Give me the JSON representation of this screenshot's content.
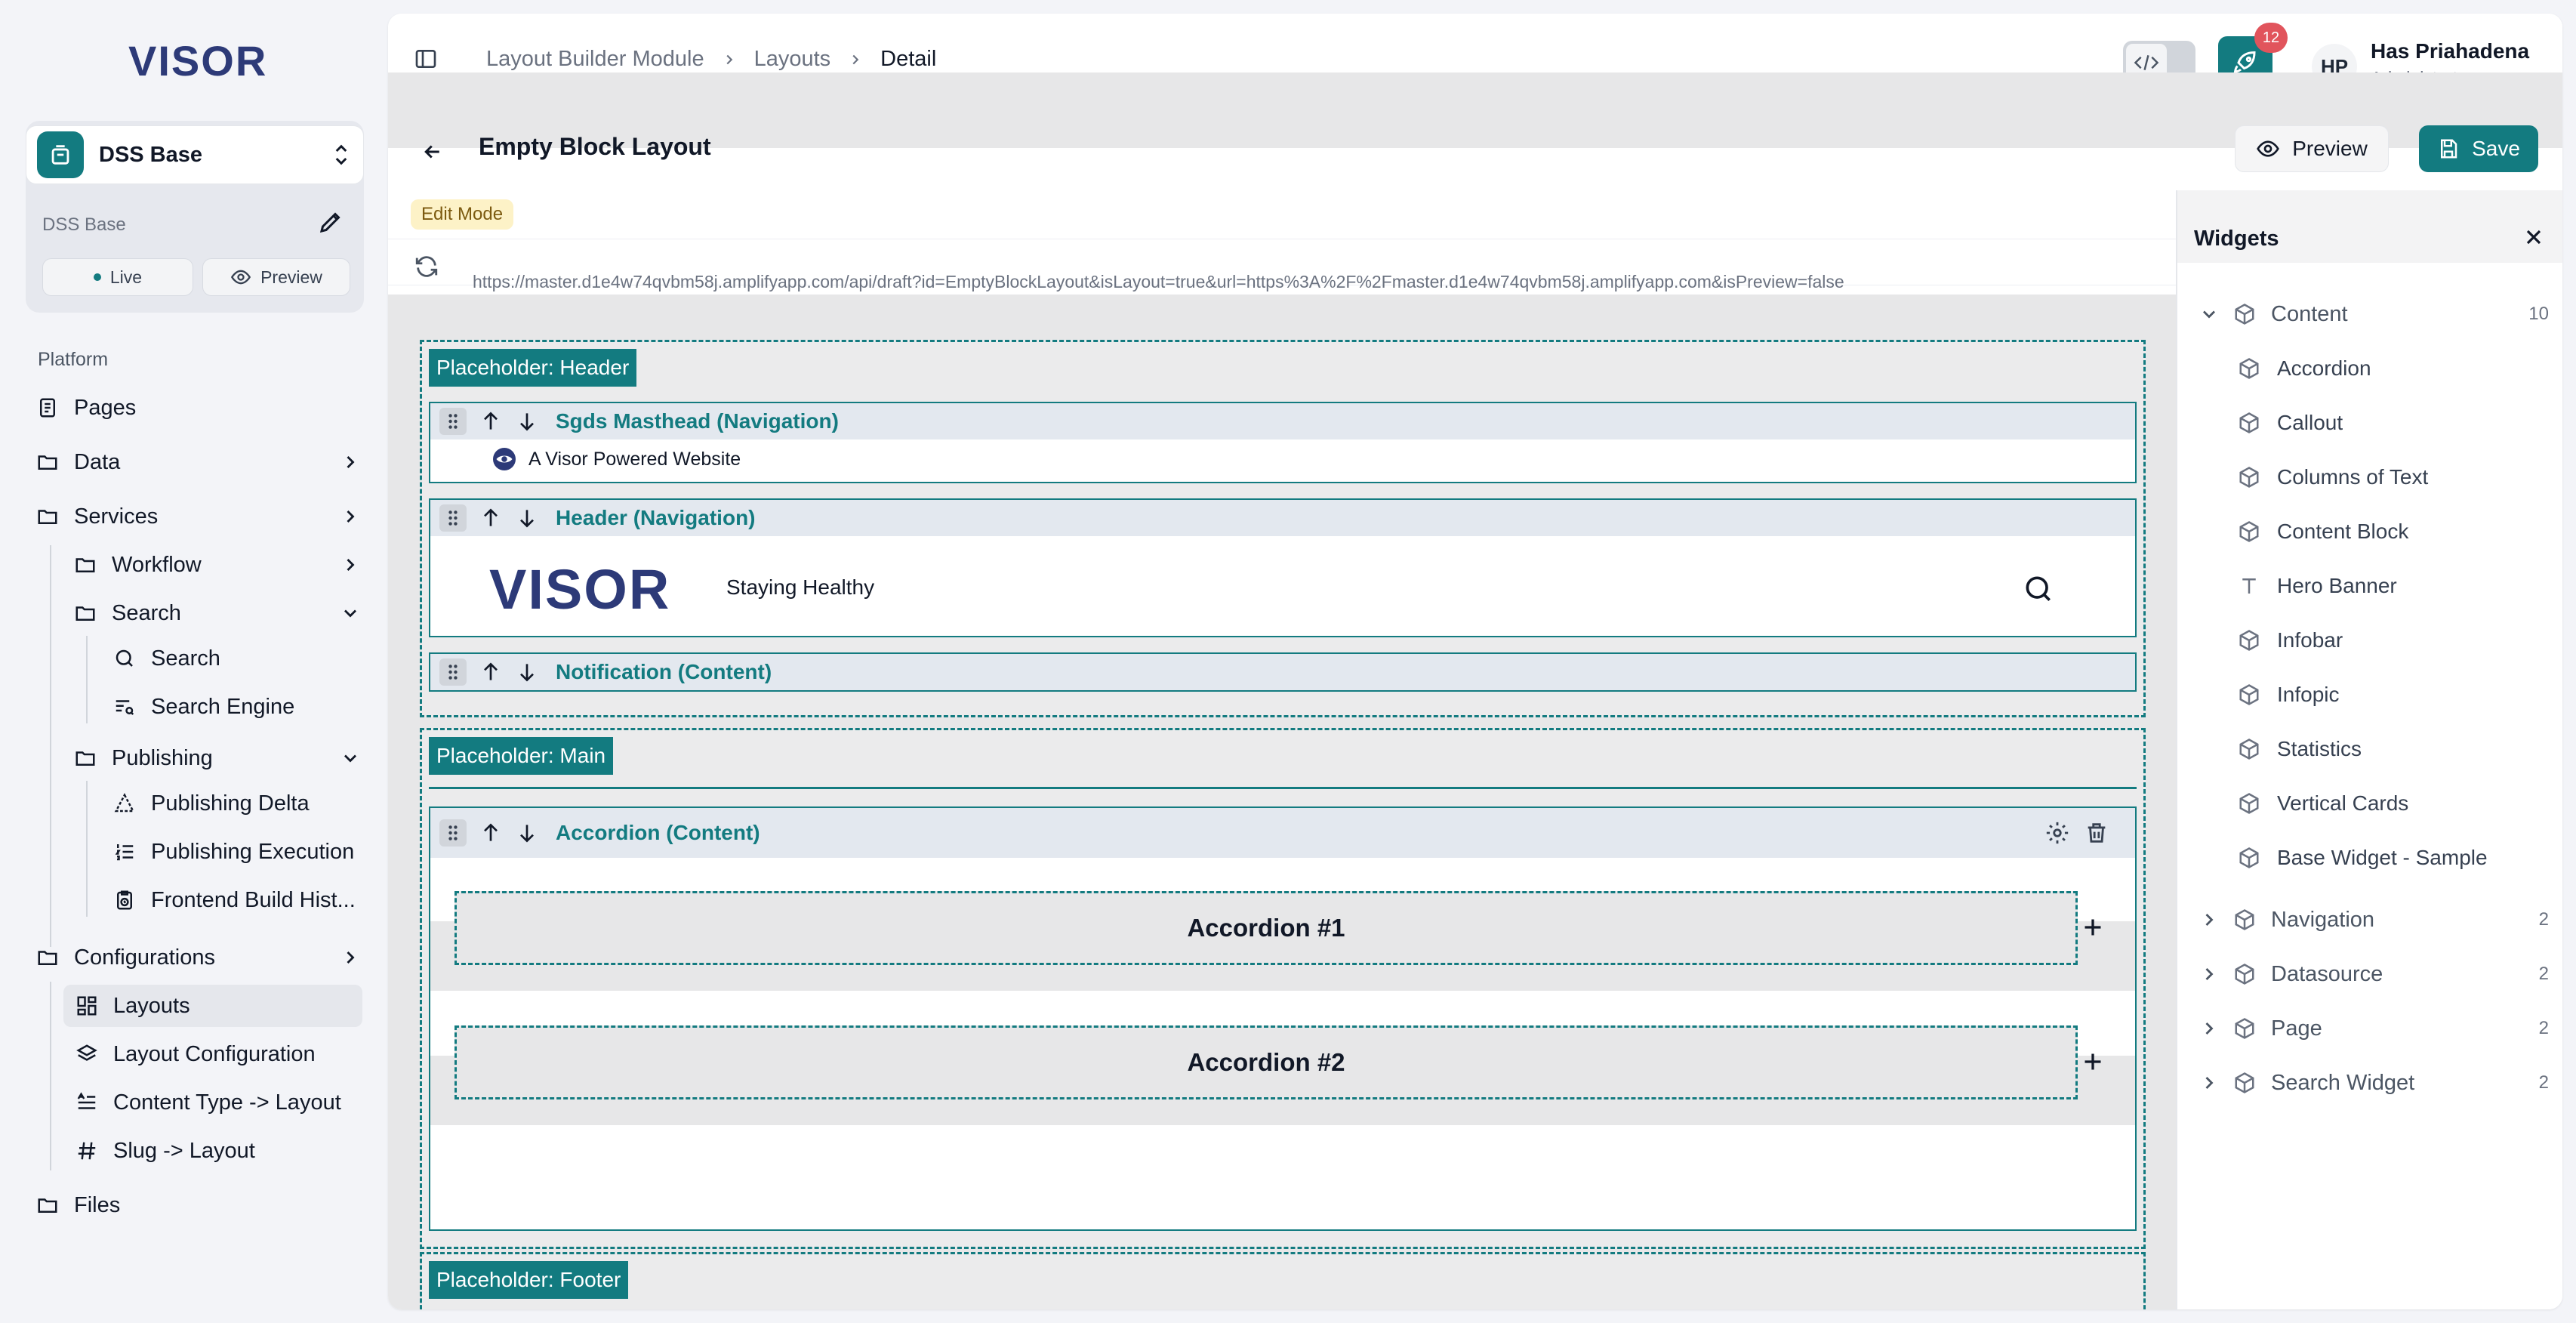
{
  "sidebar": {
    "logo": "VISOR",
    "workspace": {
      "name": "DSS Base",
      "sub": "DSS Base",
      "live": "Live",
      "preview": "Preview"
    },
    "section": "Platform",
    "items": [
      {
        "label": "Pages"
      },
      {
        "label": "Data"
      },
      {
        "label": "Services"
      },
      {
        "label": "Workflow"
      },
      {
        "label": "Search"
      },
      {
        "label": "Search"
      },
      {
        "label": "Search Engine"
      },
      {
        "label": "Publishing"
      },
      {
        "label": "Publishing Delta"
      },
      {
        "label": "Publishing Execution"
      },
      {
        "label": "Frontend Build Hist..."
      },
      {
        "label": "Configurations"
      },
      {
        "label": "Layouts"
      },
      {
        "label": "Layout Configuration"
      },
      {
        "label": "Content Type -> Layout"
      },
      {
        "label": "Slug -> Layout"
      },
      {
        "label": "Files"
      }
    ]
  },
  "topbar": {
    "breadcrumbs": [
      "Layout Builder Module",
      "Layouts",
      "Detail"
    ],
    "badge": "12",
    "user": {
      "initials": "HP",
      "name": "Has Priahadena",
      "role": "Administrator"
    }
  },
  "page": {
    "title": "Empty Block Layout",
    "preview_label": "Preview",
    "save_label": "Save",
    "mode": "Edit Mode",
    "url": "https://master.d1e4w74qvbm58j.amplifyapp.com/api/draft?id=EmptyBlockLayout&isLayout=true&url=https%3A%2F%2Fmaster.d1e4w74qvbm58j.amplifyapp.com&isPreview=false"
  },
  "canvas": {
    "header_tag": "Placeholder: Header",
    "masthead_title": "Sgds Masthead (Navigation)",
    "masthead_text": "A Visor Powered Website",
    "header_title": "Header (Navigation)",
    "header_logo": "VISOR",
    "header_tagline": "Staying Healthy",
    "notification_title": "Notification (Content)",
    "main_tag": "Placeholder: Main",
    "accordion_title": "Accordion (Content)",
    "accordion_1": "Accordion #1",
    "accordion_2": "Accordion #2",
    "footer_tag": "Placeholder: Footer"
  },
  "widgets": {
    "title": "Widgets",
    "content_group": {
      "label": "Content",
      "count": "10"
    },
    "content_items": [
      "Accordion",
      "Callout",
      "Columns of Text",
      "Content Block",
      "Hero Banner",
      "Infobar",
      "Infopic",
      "Statistics",
      "Vertical Cards",
      "Base Widget - Sample"
    ],
    "groups": [
      {
        "label": "Navigation",
        "count": "2"
      },
      {
        "label": "Datasource",
        "count": "2"
      },
      {
        "label": "Page",
        "count": "2"
      },
      {
        "label": "Search Widget",
        "count": "2"
      }
    ]
  },
  "colors": {
    "accent": "#137b80",
    "brand": "#2d3a78",
    "badge": "#e1545c",
    "edit_badge": "#fdf2c7"
  }
}
